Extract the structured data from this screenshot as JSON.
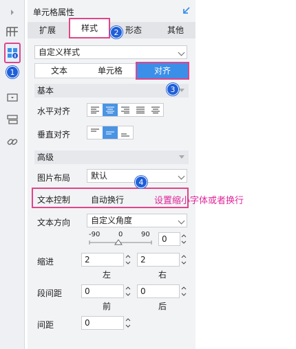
{
  "rail": {
    "items": [
      {
        "name": "collapse-arrow-icon"
      },
      {
        "name": "table-grid-icon"
      },
      {
        "name": "cell-attribute-icon"
      },
      {
        "name": "dropdown-widget-icon"
      },
      {
        "name": "layer-icon"
      },
      {
        "name": "link-icon"
      }
    ]
  },
  "panel": {
    "title": "单元格属性",
    "tabs": [
      "扩展",
      "样式",
      "形态",
      "其他"
    ],
    "style_select": "自定义样式",
    "subtabs": [
      "文本",
      "单元格",
      "对齐"
    ]
  },
  "basic": {
    "section": "基本",
    "h_align_label": "水平对齐",
    "v_align_label": "垂直对齐"
  },
  "advanced": {
    "section": "高级",
    "image_layout_label": "图片布局",
    "image_layout_value": "默认",
    "text_control_label": "文本控制",
    "text_control_value": "自动换行",
    "text_direction_label": "文本方向",
    "text_direction_value": "自定义角度",
    "angle_ticks": [
      "-90",
      "0",
      "90"
    ],
    "angle_value": "0",
    "indent_label": "缩进",
    "indent_left": "2",
    "indent_right": "2",
    "left_label": "左",
    "right_label": "右",
    "para_spacing_label": "段间距",
    "para_before": "0",
    "para_after": "0",
    "before_label": "前",
    "after_label": "后",
    "line_spacing_label": "间距",
    "line_spacing": "0"
  },
  "badges": [
    "1",
    "2",
    "3",
    "4"
  ],
  "annotation": "设置缩小字体或者换行",
  "colors": {
    "highlight": "#e0448a",
    "accent": "#3c8fe8",
    "badge": "#1f5fd8",
    "annotation": "#e0259a"
  }
}
